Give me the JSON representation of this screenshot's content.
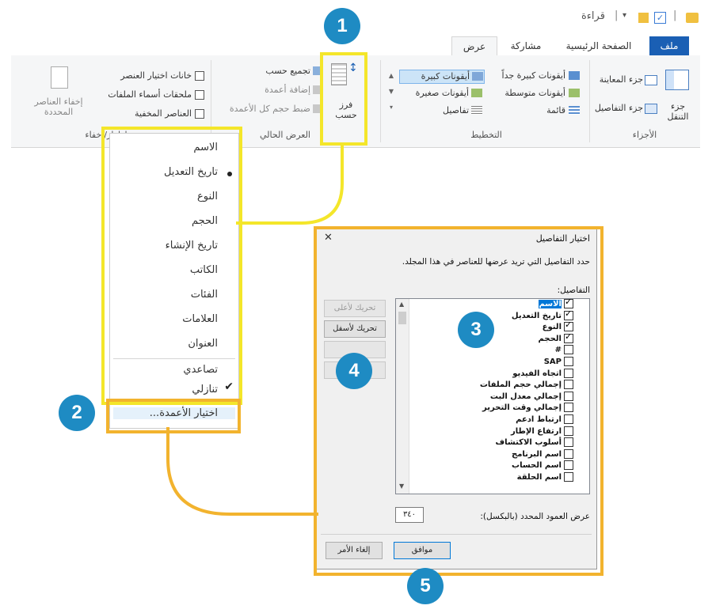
{
  "titlebar": {
    "title": "قراءة",
    "separator": "|"
  },
  "tabs": [
    {
      "label": "ملف",
      "active": false,
      "file": true
    },
    {
      "label": "الصفحة الرئيسية",
      "active": false
    },
    {
      "label": "مشاركة",
      "active": false
    },
    {
      "label": "عرض",
      "active": true
    }
  ],
  "panes_group": {
    "label": "الأجزاء",
    "nav_pane": "جزء التنقل",
    "preview_pane": "جزء المعاينة",
    "details_pane": "جزء التفاصيل"
  },
  "layout_group": {
    "label": "التخطيط",
    "items": [
      "أيقونات كبيرة جداً",
      "أيقونات كبيرة",
      "أيقونات متوسطة",
      "أيقونات صغيرة",
      "قائمة",
      "تفاصيل"
    ]
  },
  "current_view_group": {
    "label": "العرض الحالي",
    "sort_by": "فرز حسب",
    "group_by": "تجميع حسب",
    "add_columns": "إضافة أعمدة",
    "size_all_columns": "ضبط حجم كل الأعمدة"
  },
  "show_hide_group": {
    "label": "إظهار/إخفاء",
    "item_checkboxes": "خانات اختيار العنصر",
    "file_extensions": "ملحقات أسماء الملفات",
    "hidden_items": "العناصر المخفية",
    "hide_selected": "إخفاء العناصر المحددة"
  },
  "sort_menu": {
    "items": [
      "الاسم",
      "تاريخ التعديل",
      "النوع",
      "الحجم",
      "تاريخ الإنشاء",
      "الكاتب",
      "الفئات",
      "العلامات",
      "العنوان"
    ],
    "selected": "تاريخ التعديل",
    "ascending": "تصاعدي",
    "descending": "تنازلي",
    "choose_columns": "اختيار الأعمدة..."
  },
  "dialog": {
    "title": "اختيار التفاصيل",
    "close": "✕",
    "instruction": "حدد التفاصيل التي تريد عرضها للعناصر في هذا المجلد.",
    "details_label": "التفاصيل:",
    "details": [
      {
        "label": "الاسم",
        "checked": true
      },
      {
        "label": "تاريخ التعديل",
        "checked": true
      },
      {
        "label": "النوع",
        "checked": true
      },
      {
        "label": "الحجم",
        "checked": true
      },
      {
        "label": "#",
        "checked": false
      },
      {
        "label": "SAP",
        "checked": false
      },
      {
        "label": "اتجاه الفيديو",
        "checked": false
      },
      {
        "label": "إجمالي حجم الملفات",
        "checked": false
      },
      {
        "label": "إجمالي معدل البت",
        "checked": false
      },
      {
        "label": "إجمالي وقت التحرير",
        "checked": false
      },
      {
        "label": "ارتباط ادعم",
        "checked": false
      },
      {
        "label": "ارتفاع الإطار",
        "checked": false
      },
      {
        "label": "أسلوب الاكتشاف",
        "checked": false
      },
      {
        "label": "اسم البرنامج",
        "checked": false
      },
      {
        "label": "اسم الحساب",
        "checked": false
      },
      {
        "label": "اسم الحلقة",
        "checked": false
      }
    ],
    "move_up": "تحريك لأعلى",
    "move_down": "تحريك لأسفل",
    "width_label": "عرض العمود المحدد (بالبكسل):",
    "width_value": "٣٤٠",
    "ok": "موافق",
    "cancel": "إلغاء الأمر"
  },
  "callouts": [
    "1",
    "2",
    "3",
    "4",
    "5"
  ],
  "colors": {
    "callout": "#1e8bc3",
    "highlight_yellow": "#f4e62a",
    "highlight_orange": "#f2b32e",
    "file_tab": "#1a5fb4"
  }
}
